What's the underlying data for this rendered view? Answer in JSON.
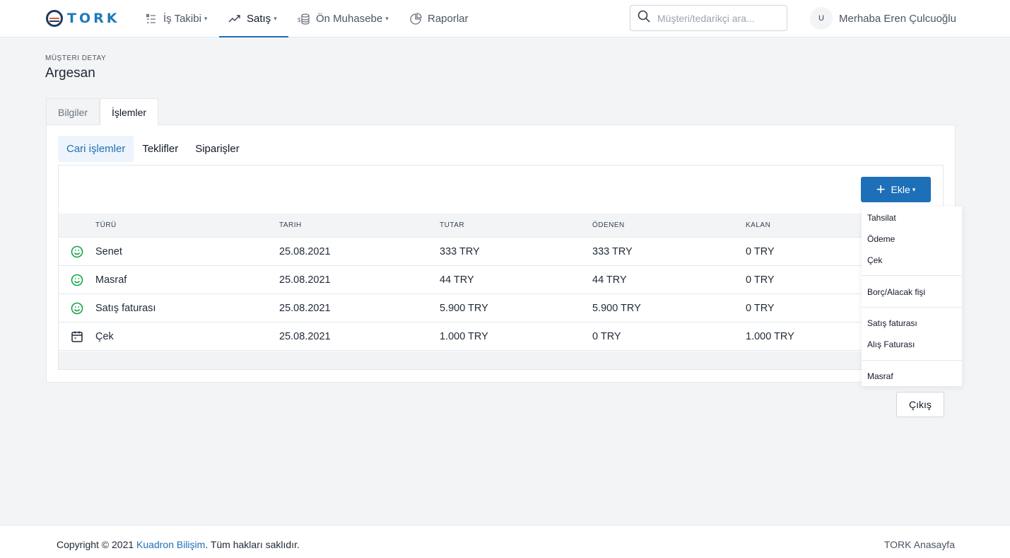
{
  "brand": {
    "name": "TORK",
    "accent": "#1d6fb8"
  },
  "nav": {
    "items": [
      {
        "label": "İş Takibi",
        "icon": "task-list-icon",
        "has_dropdown": true,
        "active": false
      },
      {
        "label": "Satış",
        "icon": "trend-up-icon",
        "has_dropdown": true,
        "active": true
      },
      {
        "label": "Ön Muhasebe",
        "icon": "coins-icon",
        "has_dropdown": true,
        "active": false
      },
      {
        "label": "Raporlar",
        "icon": "pie-chart-icon",
        "has_dropdown": false,
        "active": false
      }
    ],
    "search_placeholder": "Müşteri/tedarikçi ara...",
    "user_initial": "U",
    "user_greeting": "Merhaba Eren Çulcuoğlu"
  },
  "page": {
    "eyebrow": "MÜŞTERI DETAY",
    "title": "Argesan",
    "tabs": [
      "Bilgiler",
      "İşlemler"
    ],
    "active_tab": "İşlemler",
    "subtabs": [
      "Cari işlemler",
      "Teklifler",
      "Siparişler"
    ],
    "active_subtab": "Cari işlemler"
  },
  "toolbar": {
    "add_label": "Ekle"
  },
  "table": {
    "columns": [
      "TÜRÜ",
      "TARIH",
      "TUTAR",
      "ÖDENEN",
      "KALAN"
    ],
    "rows": [
      {
        "icon": "smiley-icon",
        "type": "Senet",
        "date": "25.08.2021",
        "amount": "333 TRY",
        "paid": "333 TRY",
        "remaining": "0 TRY"
      },
      {
        "icon": "smiley-icon",
        "type": "Masraf",
        "date": "25.08.2021",
        "amount": "44 TRY",
        "paid": "44 TRY",
        "remaining": "0 TRY"
      },
      {
        "icon": "smiley-icon",
        "type": "Satış faturası",
        "date": "25.08.2021",
        "amount": "5.900 TRY",
        "paid": "5.900 TRY",
        "remaining": "0 TRY"
      },
      {
        "icon": "calendar-icon",
        "type": "Çek",
        "date": "25.08.2021",
        "amount": "1.000 TRY",
        "paid": "0 TRY",
        "remaining": "1.000 TRY"
      }
    ]
  },
  "dropdown": {
    "groups": [
      [
        "Tahsilat",
        "Ödeme",
        "Çek"
      ],
      [
        "Borç/Alacak fişi"
      ],
      [
        "Satış faturası",
        "Alış Faturası"
      ],
      [
        "Masraf"
      ]
    ]
  },
  "actions": {
    "exit_label": "Çıkış"
  },
  "footer": {
    "copyright_prefix": "Copyright © 2021",
    "company": "Kuadron Bilişim",
    "rights": "Tüm hakları saklıdır.",
    "home_link": "TORK Anasayfa"
  },
  "colors": {
    "primary": "#1d6fb8",
    "success": "#16a34a",
    "text": "#1f2937"
  }
}
